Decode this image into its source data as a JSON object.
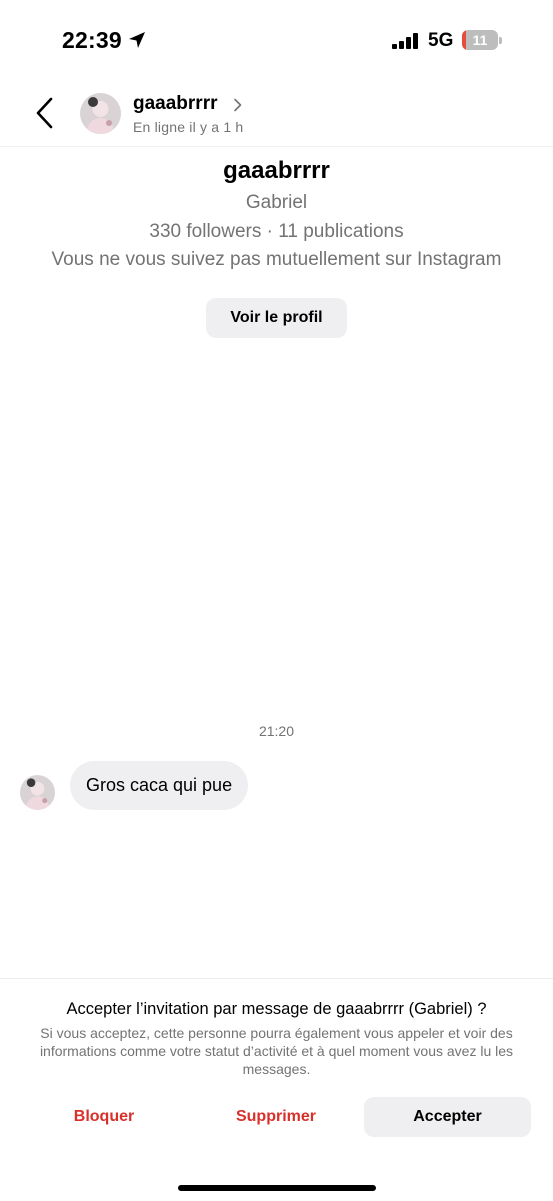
{
  "status_bar": {
    "time": "22:39",
    "network": "5G",
    "battery_level": "11",
    "battery_fraction": 0.11,
    "icons": [
      "location-arrow-icon",
      "signal-bars-icon",
      "battery-icon"
    ]
  },
  "header": {
    "username": "gaaabrrrr",
    "status": "En ligne il y a 1 h",
    "icons": [
      "back-icon",
      "chevron-right-icon"
    ]
  },
  "profile": {
    "username": "gaaabrrrr",
    "full_name": "Gabriel",
    "stats": "330 followers · 11 publications",
    "mutual": "Vous ne vous suivez pas mutuellement sur Instagram",
    "view_profile_label": "Voir le profil"
  },
  "conversation": {
    "timestamp": "21:20",
    "messages": [
      {
        "text": "Gros caca qui pue"
      }
    ]
  },
  "request": {
    "title": "Accepter l’invitation par message de gaaabrrrr (Gabriel) ?",
    "description": "Si vous acceptez, cette personne pourra également vous appeler et voir des informations comme votre statut d’activité et à quel moment vous avez lu les messages.",
    "block_label": "Bloquer",
    "delete_label": "Supprimer",
    "accept_label": "Accepter"
  },
  "colors": {
    "destructive": "#d9302a",
    "secondary_text": "#737373",
    "bubble": "#efeff1",
    "battery_low": "#e84a3f"
  }
}
